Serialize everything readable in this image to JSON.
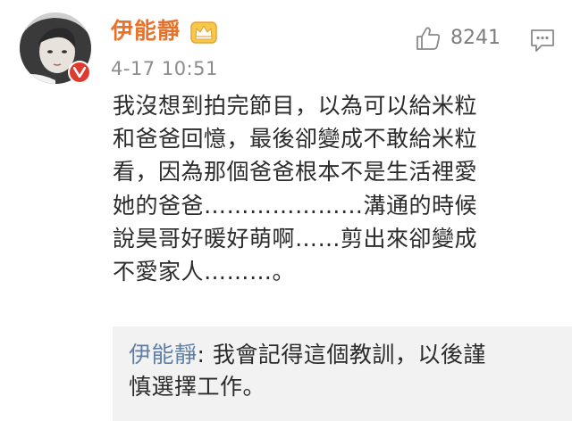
{
  "post": {
    "author": "伊能靜",
    "timestamp": "4-17 10:51",
    "likes": "8241",
    "text": "我沒想到拍完節目，以為可以給米粒\n和爸爸回憶，最後卻變成不敢給米粒\n看，因為那個爸爸根本不是生活裡愛\n她的爸爸…………………溝通的時候\n說昊哥好暖好萌啊……剪出來卻變成\n不愛家人………。"
  },
  "reply": {
    "author": "伊能靜",
    "separator": ": ",
    "text": "我會記得這個教訓，以後謹\n慎選擇工作。"
  },
  "icons": {
    "avatar": "avatar-photo",
    "verified": "verified-v-badge",
    "crown": "crown-icon",
    "like": "thumbs-up-icon",
    "comment": "comment-icon"
  },
  "colors": {
    "author_name": "#e9722a",
    "verified_badge": "#e03a2f",
    "reply_author": "#5f7fa6",
    "reply_background": "#f2f2f2"
  }
}
